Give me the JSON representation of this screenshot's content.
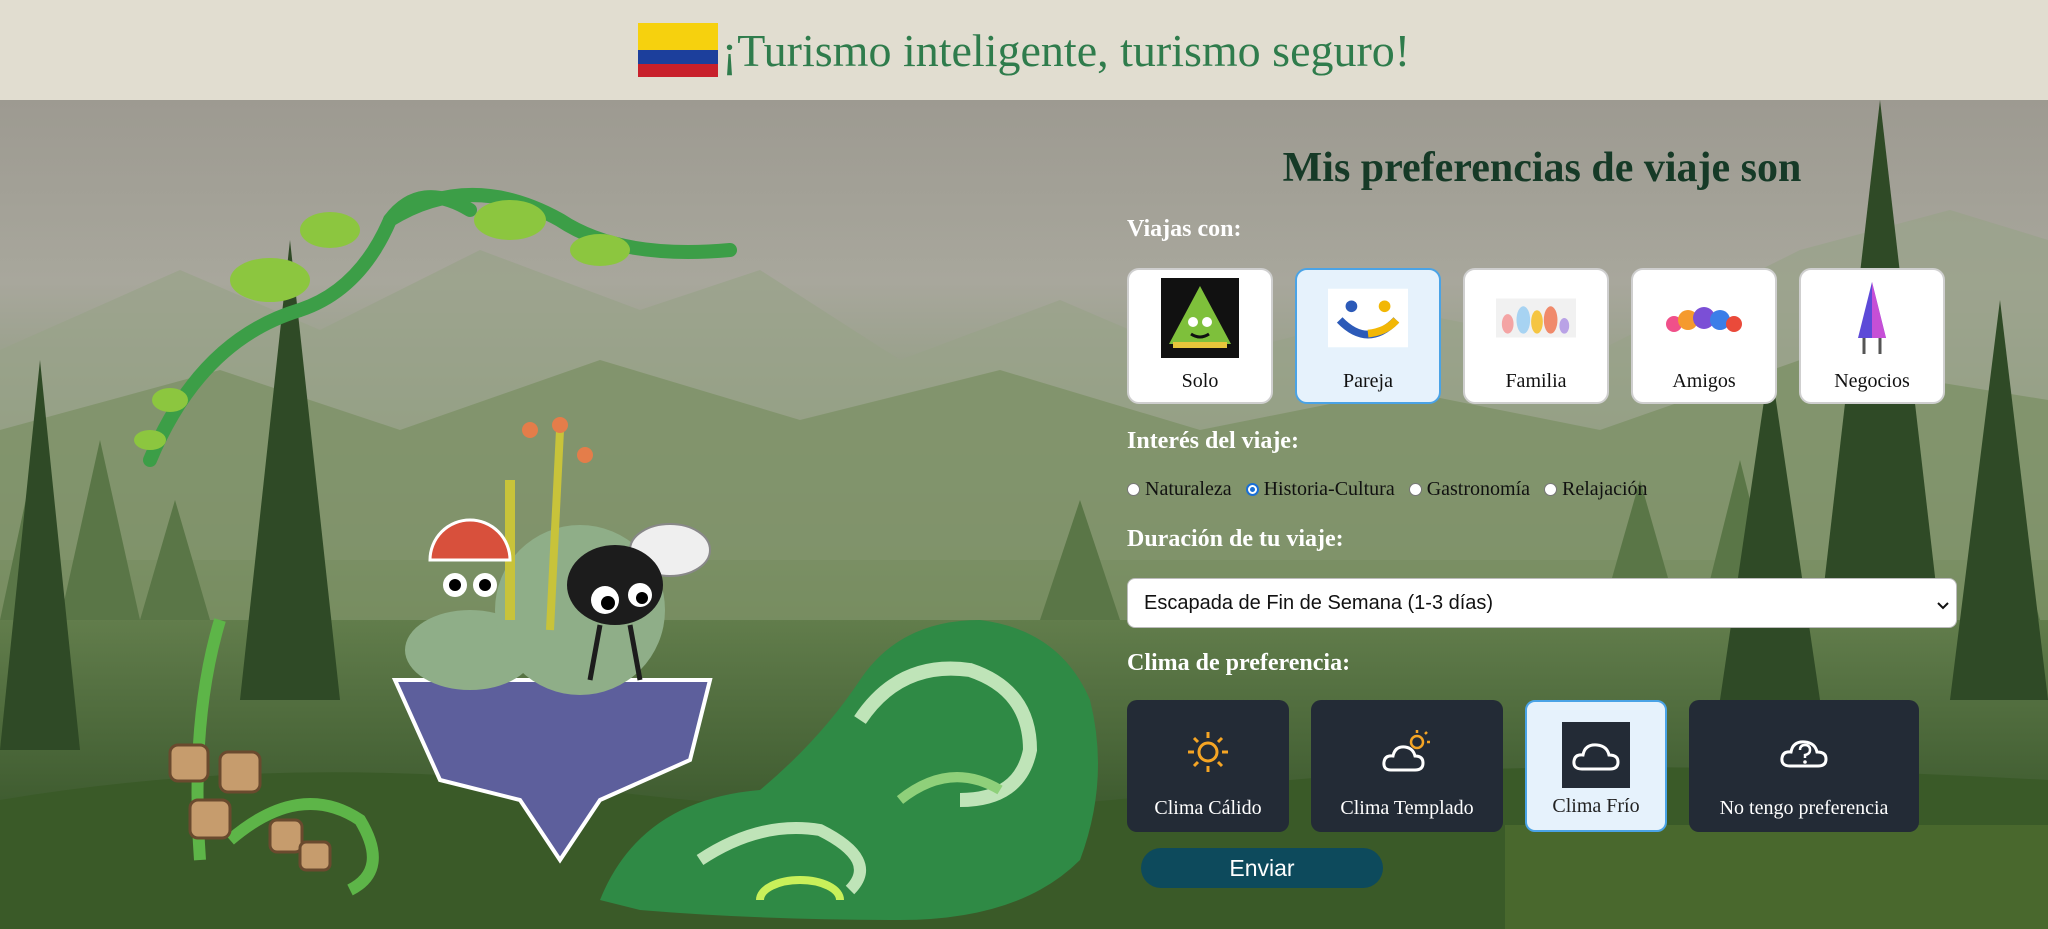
{
  "header": {
    "title": "¡Turismo inteligente, turismo seguro!",
    "flag_icon": "colombia-flag-icon"
  },
  "form": {
    "title": "Mis preferencias de viaje son",
    "companions": {
      "label": "Viajas con:",
      "options": [
        {
          "label": "Solo",
          "icon": "tree-character-icon",
          "selected": false
        },
        {
          "label": "Pareja",
          "icon": "smiley-couple-icon",
          "selected": true
        },
        {
          "label": "Familia",
          "icon": "family-figures-icon",
          "selected": false
        },
        {
          "label": "Amigos",
          "icon": "friends-blobs-icon",
          "selected": false
        },
        {
          "label": "Negocios",
          "icon": "business-cone-icon",
          "selected": false
        }
      ]
    },
    "interest": {
      "label": "Interés del viaje:",
      "options": [
        {
          "label": "Naturaleza",
          "checked": false
        },
        {
          "label": "Historia-Cultura",
          "checked": true
        },
        {
          "label": "Gastronomía",
          "checked": false
        },
        {
          "label": "Relajación",
          "checked": false
        }
      ]
    },
    "duration": {
      "label": "Duración de tu viaje:",
      "selected": "Escapada de Fin de Semana (1-3 días)"
    },
    "climate": {
      "label": "Clima de preferencia:",
      "options": [
        {
          "label": "Clima Cálido",
          "icon": "sun-icon",
          "selected": false
        },
        {
          "label": "Clima Templado",
          "icon": "sun-cloud-icon",
          "selected": false
        },
        {
          "label": "Clima Frío",
          "icon": "cloud-icon",
          "selected": true
        },
        {
          "label": "No tengo preferencia",
          "icon": "question-cloud-icon",
          "selected": false
        }
      ]
    },
    "submit_label": "Enviar"
  },
  "colors": {
    "header_bg": "#e1ddd0",
    "title_green": "#2f7c4c",
    "heading_dark_green": "#163a27",
    "selected_blue": "#4aa3e6",
    "climate_card_bg": "#232b36",
    "button_bg": "#0d4a5c"
  }
}
